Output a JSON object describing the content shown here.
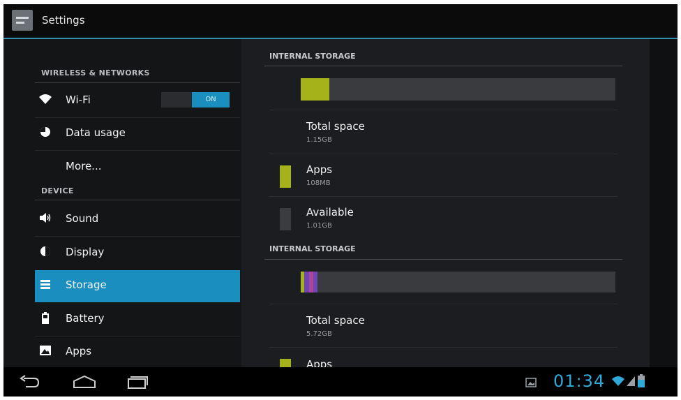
{
  "actionbar": {
    "title": "Settings",
    "icon": "settings-icon"
  },
  "sidebar": {
    "sections": [
      {
        "header": "WIRELESS & NETWORKS"
      },
      {
        "header": "DEVICE"
      }
    ],
    "items": [
      {
        "label": "Wi-Fi",
        "icon": "wifi-icon"
      },
      {
        "label": "Data usage",
        "icon": "data-usage-icon"
      },
      {
        "label": "More...",
        "icon": ""
      },
      {
        "label": "Sound",
        "icon": "speaker-icon"
      },
      {
        "label": "Display",
        "icon": "display-icon"
      },
      {
        "label": "Storage",
        "icon": "storage-icon",
        "selected": true
      },
      {
        "label": "Battery",
        "icon": "battery-icon"
      },
      {
        "label": "Apps",
        "icon": "apps-icon"
      }
    ],
    "wifi_toggle": {
      "state": "ON"
    }
  },
  "main": {
    "storage_sections": [
      {
        "header": "INTERNAL STORAGE",
        "items": [
          {
            "title": "Total space",
            "value": "1.15GB"
          },
          {
            "title": "Apps",
            "value": "108MB",
            "color": "#a6b21a"
          },
          {
            "title": "Available",
            "value": "1.01GB",
            "color": "#3b3c3f"
          }
        ]
      },
      {
        "header": "INTERNAL STORAGE",
        "items": [
          {
            "title": "Total space",
            "value": "5.72GB"
          },
          {
            "title": "Apps",
            "value": "",
            "color": "#a6b21a"
          }
        ]
      }
    ]
  },
  "navbar": {
    "clock": "01:34"
  },
  "colors": {
    "accent": "#1a8fbf",
    "apps": "#a6b21a",
    "clock": "#2ea9d8"
  }
}
